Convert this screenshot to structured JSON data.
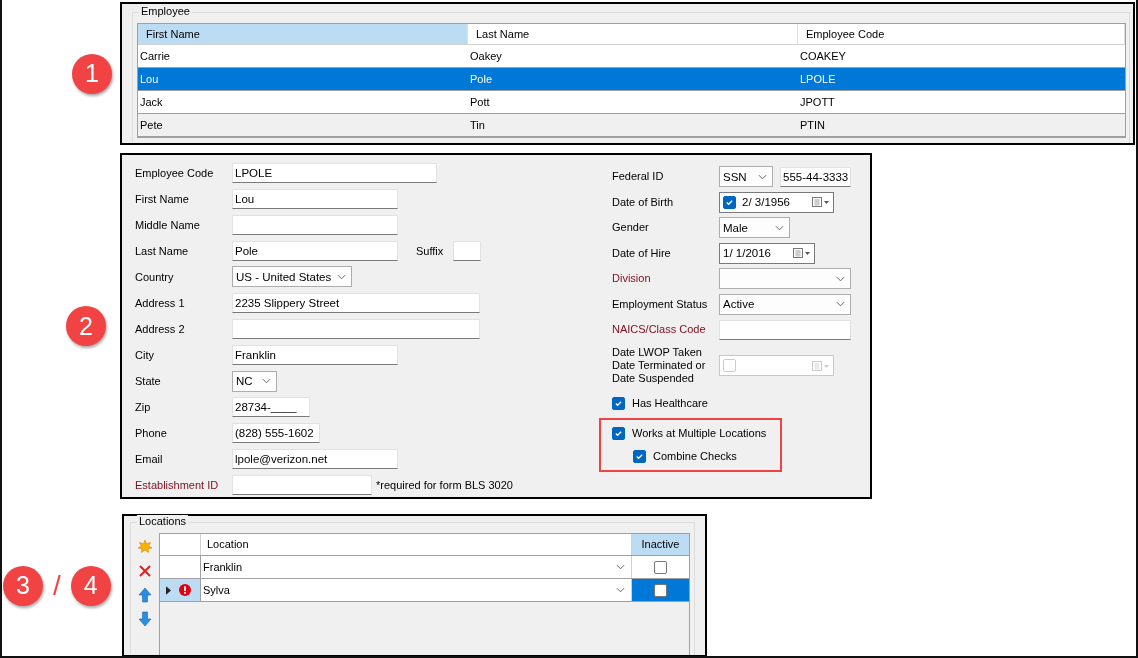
{
  "employee_panel": {
    "callouts": [
      "1"
    ],
    "group_title": "Employee",
    "columns": [
      {
        "label": "First Name",
        "selected": true
      },
      {
        "label": "Last Name",
        "selected": false
      },
      {
        "label": "Employee Code",
        "selected": false
      }
    ],
    "rows": [
      {
        "cells": [
          "Carrie",
          "Oakey",
          "COAKEY"
        ],
        "selected": false,
        "highlighted": false
      },
      {
        "cells": [
          "Lou",
          "Pole",
          "LPOLE"
        ],
        "selected": true,
        "highlighted": false
      },
      {
        "cells": [
          "Jack",
          "Pott",
          "JPOTT"
        ],
        "selected": false,
        "highlighted": false
      },
      {
        "cells": [
          "Pete",
          "Tin",
          "PTIN"
        ],
        "selected": false,
        "highlighted": true
      }
    ]
  },
  "details_panel": {
    "callouts": [
      "2"
    ],
    "left_fields": [
      {
        "label": "Employee Code",
        "kind": "text",
        "value": "LPOLE",
        "required": false
      },
      {
        "label": "First Name",
        "kind": "text",
        "value": "Lou",
        "required": false
      },
      {
        "label": "Middle Name",
        "kind": "text",
        "required": false
      },
      {
        "label": "Last Name",
        "kind": "text",
        "value": "Pole",
        "required": false,
        "suffix": {
          "label": "Suffix"
        }
      },
      {
        "label": "Country",
        "kind": "select",
        "value": "US - United States",
        "required": false
      },
      {
        "label": "Address 1",
        "kind": "text",
        "value": "2235 Slippery Street",
        "required": false
      },
      {
        "label": "Address 2",
        "kind": "text",
        "required": false
      },
      {
        "label": "City",
        "kind": "text",
        "value": "Franklin",
        "required": false
      },
      {
        "label": "State",
        "kind": "select",
        "value": "NC",
        "required": false
      },
      {
        "label": "Zip",
        "kind": "text",
        "value": "28734-____",
        "required": false
      },
      {
        "label": "Phone",
        "kind": "text",
        "value": "(828) 555-1602",
        "required": false
      },
      {
        "label": "Email",
        "kind": "text",
        "value": "lpole@verizon.net",
        "required": false
      },
      {
        "label": "Establishment ID",
        "kind": "text",
        "required": true,
        "note": "*required for form BLS 3020"
      }
    ],
    "right_fields": [
      {
        "label": "Federal ID",
        "kind": "select_text",
        "select": "SSN",
        "value": "555-44-3333",
        "required": false
      },
      {
        "label": "Date of Birth",
        "kind": "date",
        "value": "2/ 3/1956",
        "has_checkbox": true,
        "checked": true,
        "disabled": false,
        "required": false
      },
      {
        "label": "Gender",
        "kind": "select",
        "value": "Male",
        "required": false
      },
      {
        "label": "Date of Hire",
        "kind": "date",
        "value": "1/ 1/2016",
        "has_checkbox": false,
        "disabled": false,
        "required": false
      },
      {
        "label": "Division",
        "kind": "select",
        "required": true
      },
      {
        "label": "Employment Status",
        "kind": "select",
        "value": "Active",
        "required": false
      },
      {
        "label": "NAICS/Class Code",
        "kind": "text",
        "required": true
      },
      {
        "label": "Date LWOP Taken\nDate Terminated or\nDate Suspended",
        "kind": "date",
        "has_checkbox": true,
        "checked": false,
        "disabled": true,
        "required": false
      }
    ],
    "checkboxes": [
      {
        "label": "Has Healthcare",
        "checked": true,
        "highlighted": false
      },
      {
        "label": "Works at Multiple Locations",
        "checked": true,
        "highlighted": true,
        "children": [
          {
            "label": "Combine Checks",
            "checked": true
          }
        ]
      }
    ]
  },
  "locations_panel": {
    "callouts": [
      "3",
      "/",
      "4"
    ],
    "group_title": "Locations",
    "columns": [
      {
        "label": "Location",
        "selected": false
      },
      {
        "label": "Inactive",
        "selected": true
      }
    ],
    "rows": [
      {
        "location": "Franklin",
        "inactive": false,
        "current": false,
        "error": false,
        "selected": false
      },
      {
        "location": "Sylva",
        "inactive": false,
        "current": true,
        "error": true,
        "selected": true
      }
    ]
  }
}
